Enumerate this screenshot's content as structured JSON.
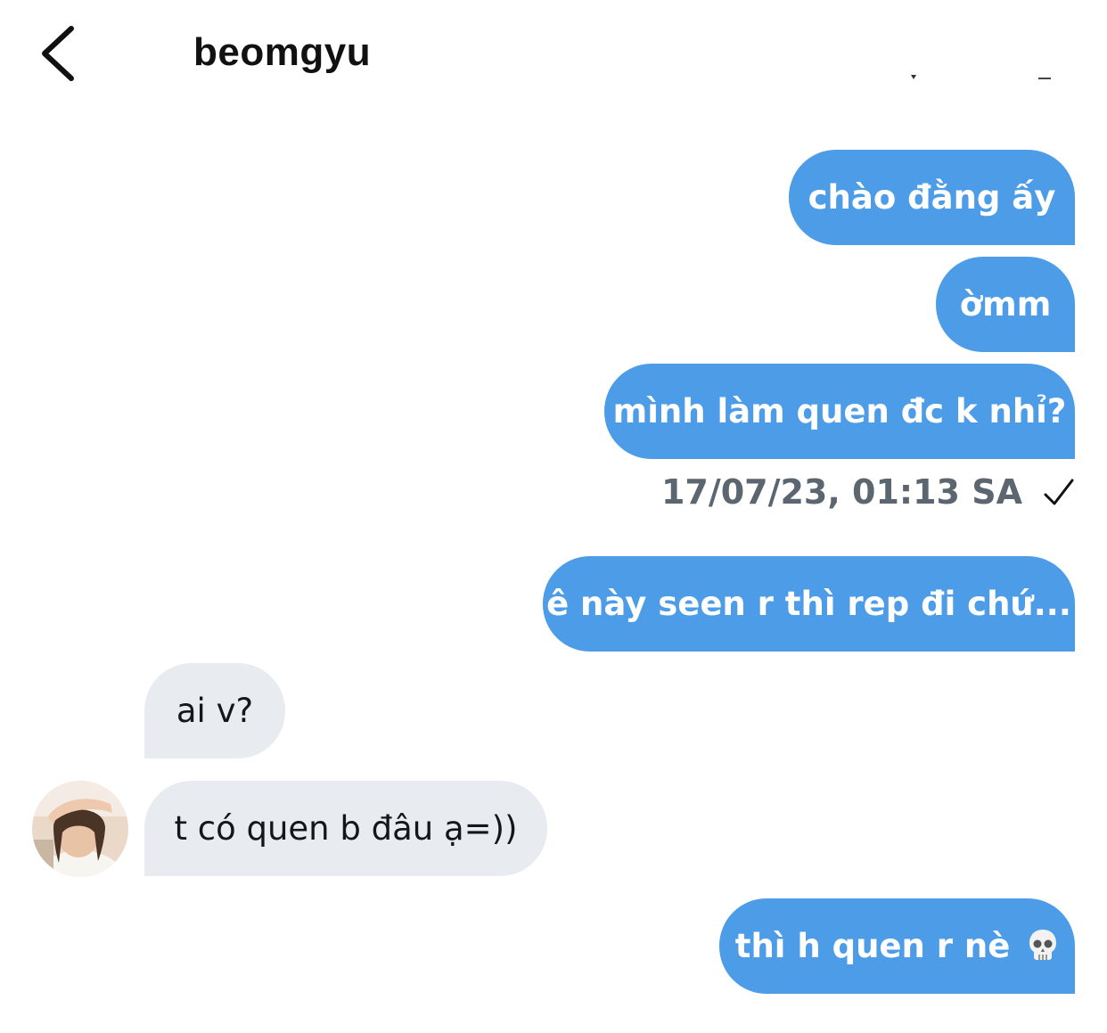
{
  "header": {
    "title": "beomgyu"
  },
  "messages": {
    "m1": "chào đằng ấy",
    "m2": "ờmm",
    "m3": "mình làm quen đc k nhỉ?",
    "timestamp": "17/07/23, 01:13 SA",
    "m4": "ê này seen r thì rep đi chứ...",
    "r1": "ai v?",
    "r2": "t có quen b đâu ạ=))",
    "m5": "thì h quen r nè"
  },
  "icons": {
    "back": "chevron-left-icon",
    "read": "checkmark-icon",
    "avatar": "user-avatar",
    "emoji": "skull-emoji"
  },
  "colors": {
    "outgoing": "#4d9ce8",
    "incoming": "#e8ecf0",
    "timestamp": "#5b6670"
  }
}
